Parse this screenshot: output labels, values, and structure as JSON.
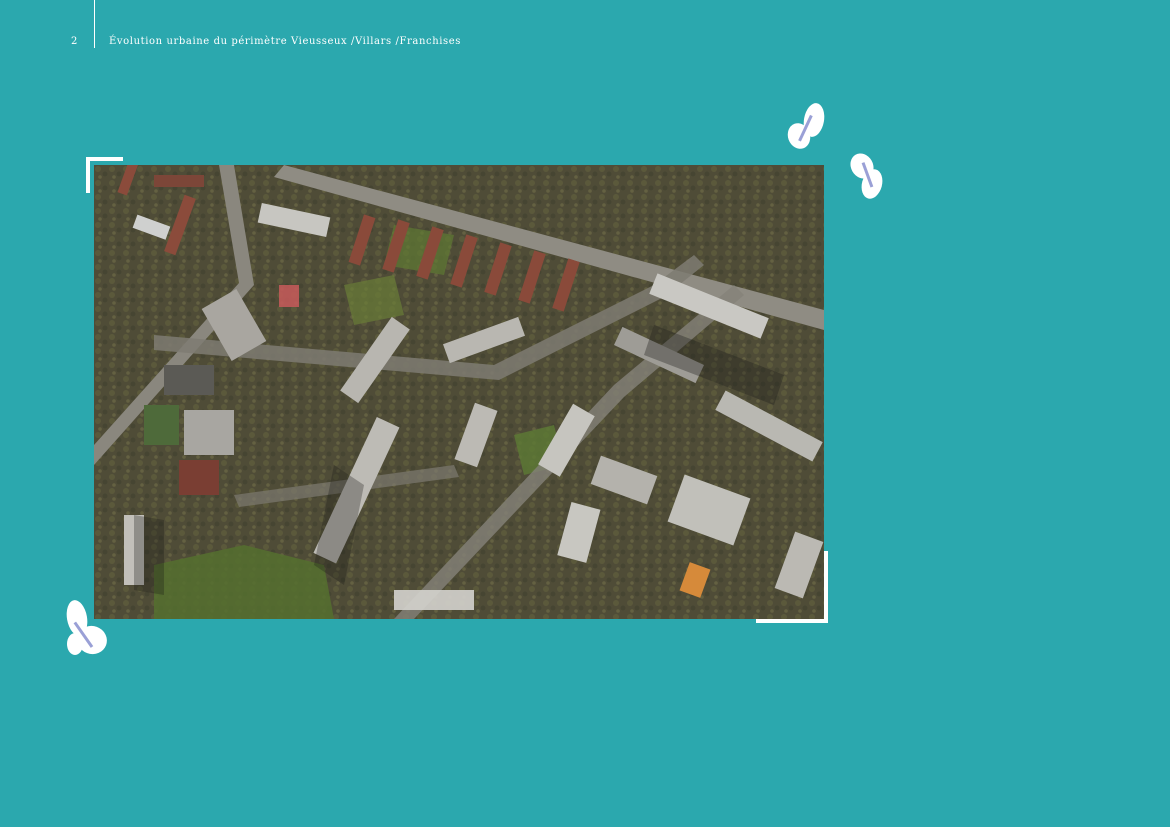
{
  "header": {
    "page_number": "2",
    "running_title": "Évolution urbaine du périmètre Vieusseux /Villars /Franchises"
  },
  "colors": {
    "background": "#2ba8ae",
    "accent_text": "#ffffff",
    "frame": "#ffffff"
  },
  "figure": {
    "icon": "aerial-photo-icon"
  },
  "decorations": {
    "icons": [
      "butterfly-icon",
      "butterfly-icon",
      "butterfly-icon"
    ]
  }
}
